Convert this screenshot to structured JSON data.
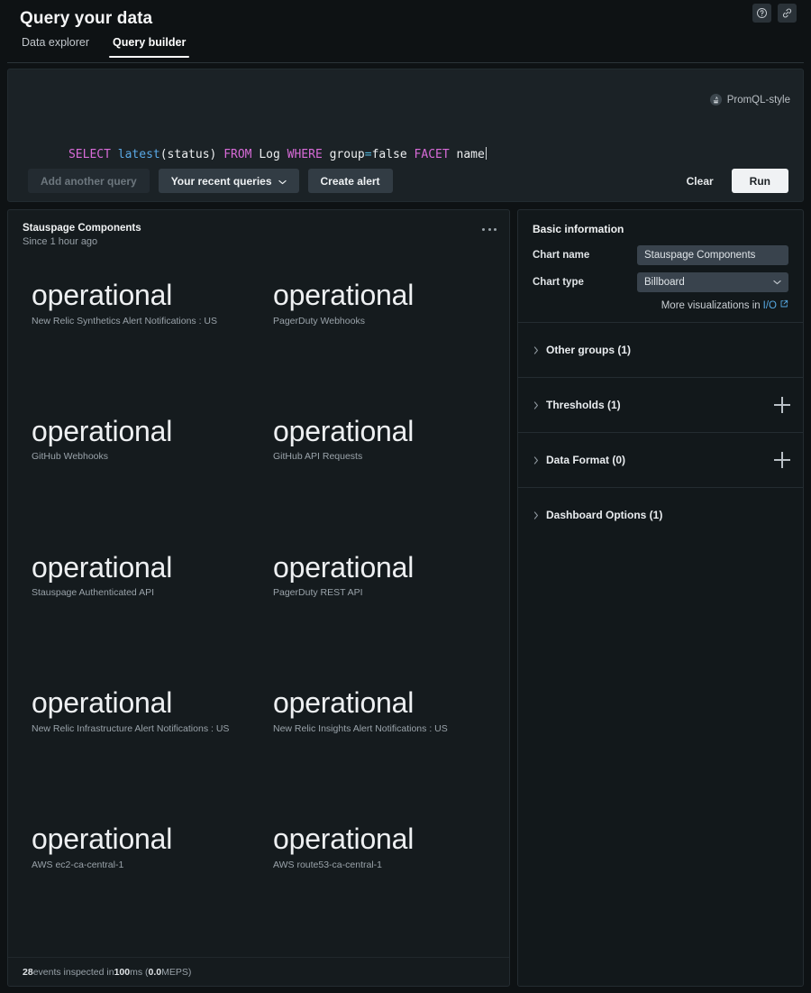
{
  "header": {
    "title": "Query your data",
    "help_icon": "help-circle-icon",
    "link_icon": "link-icon",
    "tabs": [
      {
        "label": "Data explorer",
        "active": false
      },
      {
        "label": "Query builder",
        "active": true
      }
    ]
  },
  "query_panel": {
    "promql_label": "PromQL-style",
    "promql_icon": "prometheus-icon",
    "query_tokens": [
      {
        "text": "SELECT",
        "type": "kw"
      },
      {
        "text": " ",
        "type": "plain"
      },
      {
        "text": "latest",
        "type": "fn"
      },
      {
        "text": "(status) ",
        "type": "plain"
      },
      {
        "text": "FROM",
        "type": "kw"
      },
      {
        "text": " Log ",
        "type": "plain"
      },
      {
        "text": "WHERE",
        "type": "kw"
      },
      {
        "text": " group",
        "type": "plain"
      },
      {
        "text": "=",
        "type": "op"
      },
      {
        "text": "false ",
        "type": "plain"
      },
      {
        "text": "FACET",
        "type": "kw"
      },
      {
        "text": " name",
        "type": "plain"
      }
    ],
    "query_raw": "SELECT latest(status) FROM Log WHERE group=false FACET name",
    "add_query_label": "Add another query",
    "recent_queries_label": "Your recent queries",
    "create_alert_label": "Create alert",
    "clear_label": "Clear",
    "run_label": "Run"
  },
  "chart": {
    "title": "Stauspage Components",
    "subtitle": "Since 1 hour ago",
    "menu_icon": "kebab-menu-icon",
    "footer": {
      "events_count": "28",
      "events_text": " events inspected in ",
      "duration": "100",
      "duration_unit": " ms (",
      "meps": "0.0",
      "meps_unit": " MEPS)"
    }
  },
  "chart_data": {
    "type": "table",
    "title": "Stauspage Components",
    "subtitle": "Since 1 hour ago",
    "visualization": "Billboard",
    "facet": "name",
    "metric": "latest(status)",
    "categories": [
      "New Relic Synthetics Alert Notifications : US",
      "PagerDuty Webhooks",
      "GitHub Webhooks",
      "GitHub API Requests",
      "Stauspage Authenticated API",
      "PagerDuty REST API",
      "New Relic Infrastructure Alert Notifications : US",
      "New Relic Insights Alert Notifications : US",
      "AWS ec2-ca-central-1",
      "AWS route53-ca-central-1"
    ],
    "values": [
      "operational",
      "operational",
      "operational",
      "operational",
      "operational",
      "operational",
      "operational",
      "operational",
      "operational",
      "operational"
    ],
    "tiles": [
      {
        "value": "operational",
        "label": "New Relic Synthetics Alert Notifications : US"
      },
      {
        "value": "operational",
        "label": "PagerDuty Webhooks"
      },
      {
        "value": "operational",
        "label": "GitHub Webhooks"
      },
      {
        "value": "operational",
        "label": "GitHub API Requests"
      },
      {
        "value": "operational",
        "label": "Stauspage Authenticated API"
      },
      {
        "value": "operational",
        "label": "PagerDuty REST API"
      },
      {
        "value": "operational",
        "label": "New Relic Infrastructure Alert Notifications : US"
      },
      {
        "value": "operational",
        "label": "New Relic Insights Alert Notifications : US"
      },
      {
        "value": "operational",
        "label": "AWS ec2-ca-central-1"
      },
      {
        "value": "operational",
        "label": "AWS route53-ca-central-1"
      }
    ]
  },
  "side_panel": {
    "basic_info_title": "Basic information",
    "chart_name_label": "Chart name",
    "chart_name_value": "Stauspage Components",
    "chart_type_label": "Chart type",
    "chart_type_value": "Billboard",
    "more_viz_text": "More visualizations in ",
    "more_viz_link": "I/O",
    "sections": [
      {
        "label": "Other groups (1)",
        "has_add": false
      },
      {
        "label": "Thresholds (1)",
        "has_add": true
      },
      {
        "label": "Data Format (0)",
        "has_add": true
      },
      {
        "label": "Dashboard Options (1)",
        "has_add": false
      }
    ]
  },
  "colors": {
    "app_bg": "#0e1214",
    "panel_bg": "#151b1e",
    "query_bg": "#1b2226",
    "accent_blue": "#56a7e0",
    "keyword_magenta": "#d86bd8",
    "function_blue": "#5aa9e6",
    "field_bg": "#39434d",
    "run_button_bg": "#f0f2f4"
  }
}
